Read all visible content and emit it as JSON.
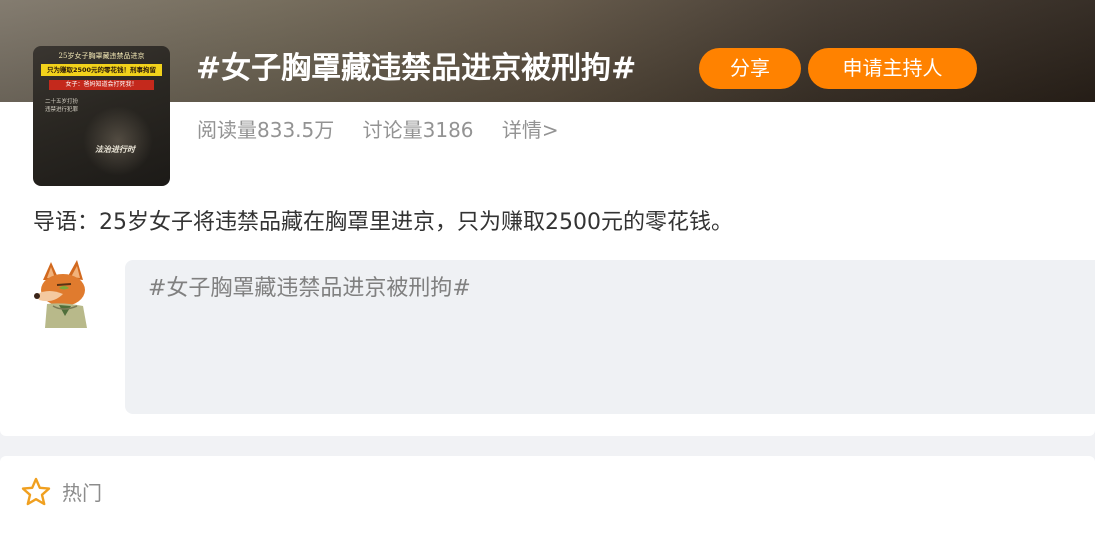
{
  "topic": {
    "title": "#女子胸罩藏违禁品进京被刑拘#",
    "share_label": "分享",
    "apply_host_label": "申请主持人",
    "stats": {
      "reads": "阅读量833.5万",
      "discussions": "讨论量3186",
      "details": "详情>"
    },
    "intro": "导语：25岁女子将违禁品藏在胸罩里进京，只为赚取2500元的零花钱。",
    "cover": {
      "title": "25岁女子胸罩藏违禁品进京",
      "highlight": "只为赚取2500元的零花钱！刑事拘留",
      "red_text": "女子：爸妈知道会打死我！",
      "small_text": "二十五岁打扮\n违禁进行犯罪",
      "brand": "法治进行时"
    },
    "colors": {
      "accent": "#ff8200"
    }
  },
  "composer": {
    "text": "#女子胸罩藏违禁品进京被刑拘#"
  },
  "hot": {
    "label": "热门",
    "icon": "star-icon"
  }
}
